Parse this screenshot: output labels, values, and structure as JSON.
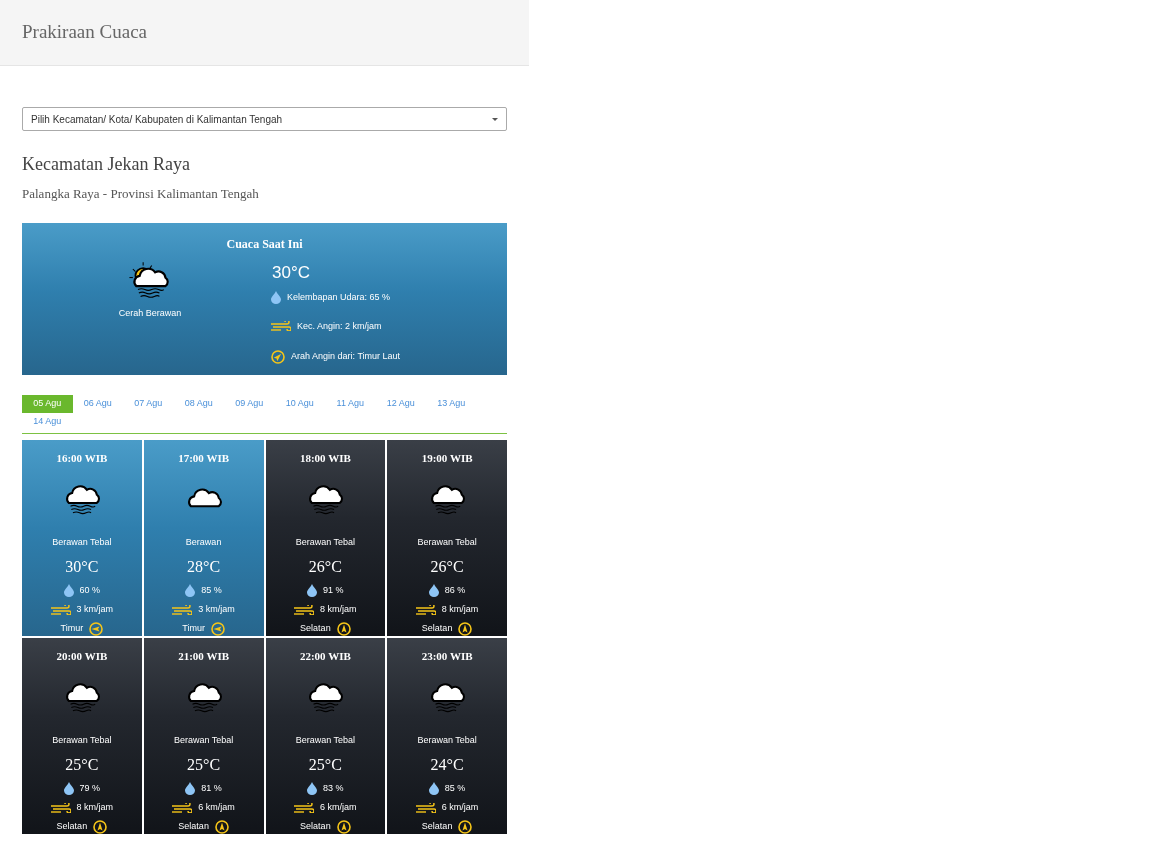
{
  "header": {
    "title": "Prakiraan Cuaca"
  },
  "location_select": {
    "value": "Pilih Kecamatan/ Kota/ Kabupaten di Kalimantan Tengah"
  },
  "location": {
    "title": "Kecamatan Jekan Raya",
    "subtitle": "Palangka Raya - Provinsi Kalimantan Tengah"
  },
  "current": {
    "heading": "Cuaca Saat Ini",
    "condition": "Cerah Berawan",
    "temperature": "30°C",
    "humidity": "Kelembapan Udara: 65 %",
    "wind_speed": "Kec. Angin: 2 km/jam",
    "wind_direction": "Arah Angin dari: Timur Laut"
  },
  "date_tabs": [
    {
      "label": "05 Agu",
      "selected": true
    },
    {
      "label": "06 Agu",
      "selected": false
    },
    {
      "label": "07 Agu",
      "selected": false
    },
    {
      "label": "08 Agu",
      "selected": false
    },
    {
      "label": "09 Agu",
      "selected": false
    },
    {
      "label": "10 Agu",
      "selected": false
    },
    {
      "label": "11 Agu",
      "selected": false
    },
    {
      "label": "12 Agu",
      "selected": false
    },
    {
      "label": "13 Agu",
      "selected": false
    },
    {
      "label": "14 Agu",
      "selected": false
    }
  ],
  "forecast": [
    {
      "time": "16:00 WIB",
      "kind": "day",
      "condition": "Berawan Tebal",
      "temperature": "30°C",
      "humidity": "60 %",
      "wind_speed": "3 km/jam",
      "direction": "Timur"
    },
    {
      "time": "17:00 WIB",
      "kind": "day",
      "condition": "Berawan",
      "temperature": "28°C",
      "humidity": "85 %",
      "wind_speed": "3 km/jam",
      "direction": "Timur"
    },
    {
      "time": "18:00 WIB",
      "kind": "night",
      "condition": "Berawan Tebal",
      "temperature": "26°C",
      "humidity": "91 %",
      "wind_speed": "8 km/jam",
      "direction": "Selatan"
    },
    {
      "time": "19:00 WIB",
      "kind": "night",
      "condition": "Berawan Tebal",
      "temperature": "26°C",
      "humidity": "86 %",
      "wind_speed": "8 km/jam",
      "direction": "Selatan"
    },
    {
      "time": "20:00 WIB",
      "kind": "night",
      "condition": "Berawan Tebal",
      "temperature": "25°C",
      "humidity": "79 %",
      "wind_speed": "8 km/jam",
      "direction": "Selatan"
    },
    {
      "time": "21:00 WIB",
      "kind": "night",
      "condition": "Berawan Tebal",
      "temperature": "25°C",
      "humidity": "81 %",
      "wind_speed": "6 km/jam",
      "direction": "Selatan"
    },
    {
      "time": "22:00 WIB",
      "kind": "night",
      "condition": "Berawan Tebal",
      "temperature": "25°C",
      "humidity": "83 %",
      "wind_speed": "6 km/jam",
      "direction": "Selatan"
    },
    {
      "time": "23:00 WIB",
      "kind": "night",
      "condition": "Berawan Tebal",
      "temperature": "24°C",
      "humidity": "85 %",
      "wind_speed": "6 km/jam",
      "direction": "Selatan"
    }
  ]
}
